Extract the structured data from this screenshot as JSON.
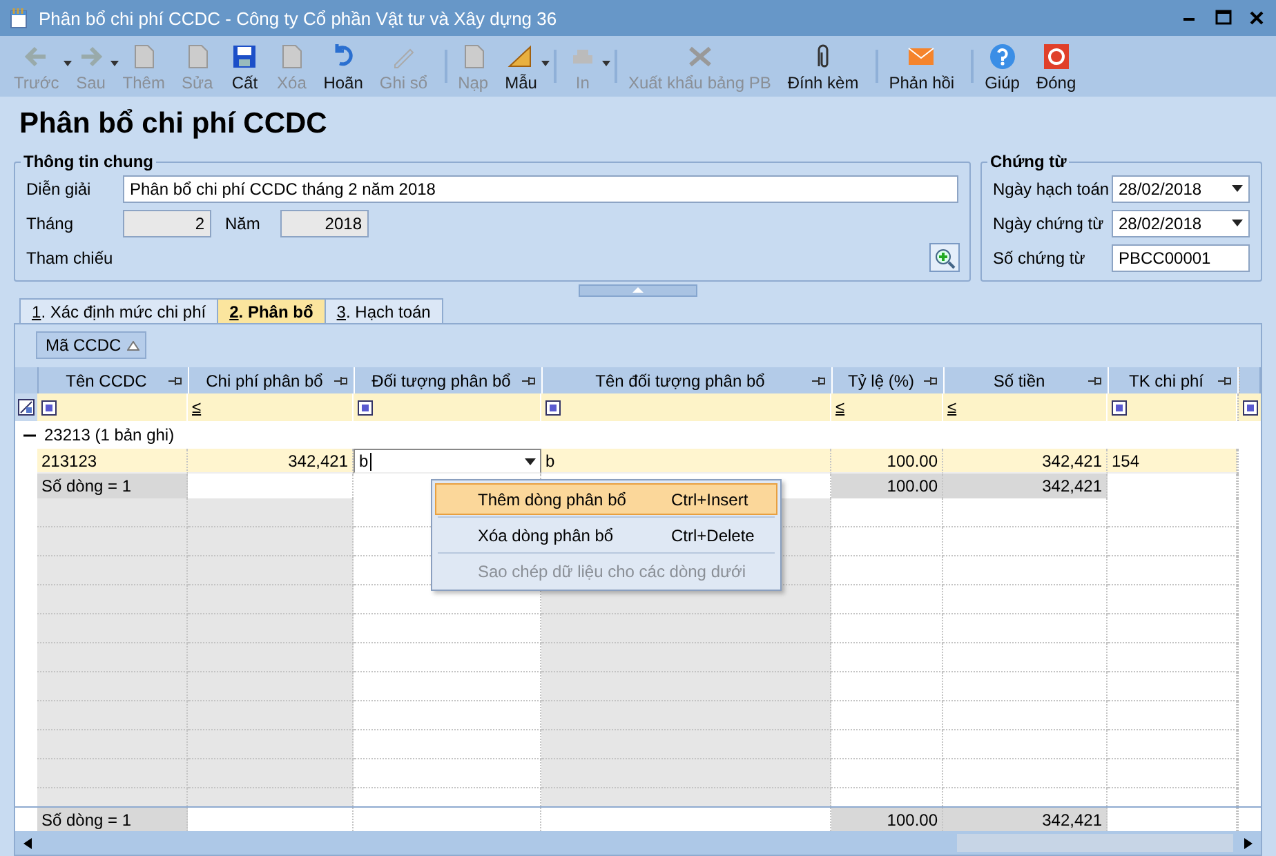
{
  "window": {
    "title": "Phân bổ chi phí CCDC - Công ty Cổ phần Vật tư và Xây dựng 36"
  },
  "toolbar": [
    {
      "label": "Trước",
      "enabled": false,
      "dropdown": true,
      "separator_after": false
    },
    {
      "label": "Sau",
      "enabled": false,
      "dropdown": true,
      "separator_after": false
    },
    {
      "label": "Thêm",
      "enabled": false,
      "dropdown": false,
      "separator_after": false
    },
    {
      "label": "Sửa",
      "enabled": false,
      "dropdown": false,
      "separator_after": false
    },
    {
      "label": "Cất",
      "enabled": true,
      "dropdown": false,
      "separator_after": false
    },
    {
      "label": "Xóa",
      "enabled": false,
      "dropdown": false,
      "separator_after": false
    },
    {
      "label": "Hoãn",
      "enabled": true,
      "dropdown": false,
      "separator_after": false
    },
    {
      "label": "Ghi sổ",
      "enabled": false,
      "dropdown": false,
      "separator_after": true
    },
    {
      "label": "Nạp",
      "enabled": false,
      "dropdown": false,
      "separator_after": false
    },
    {
      "label": "Mẫu",
      "enabled": true,
      "dropdown": true,
      "separator_after": true
    },
    {
      "label": "In",
      "enabled": false,
      "dropdown": true,
      "separator_after": true
    },
    {
      "label": "Xuất khẩu bảng PB",
      "enabled": false,
      "dropdown": false,
      "separator_after": false
    },
    {
      "label": "Đính kèm",
      "enabled": true,
      "dropdown": false,
      "separator_after": true
    },
    {
      "label": "Phản hồi",
      "enabled": true,
      "dropdown": false,
      "separator_after": true
    },
    {
      "label": "Giúp",
      "enabled": true,
      "dropdown": false,
      "separator_after": false
    },
    {
      "label": "Đóng",
      "enabled": true,
      "dropdown": false,
      "separator_after": false
    }
  ],
  "heading": "Phân bổ chi phí CCDC",
  "general": {
    "title": "Thông tin chung",
    "description_label": "Diễn giải",
    "description": "Phân bổ chi phí CCDC tháng 2 năm 2018",
    "month_label": "Tháng",
    "month": "2",
    "year_label": "Năm",
    "year": "2018",
    "reference_label": "Tham chiếu"
  },
  "voucher": {
    "title": "Chứng từ",
    "fields": [
      {
        "label": "Ngày hạch toán",
        "value": "28/02/2018",
        "kind": "date"
      },
      {
        "label": "Ngày chứng từ",
        "value": "28/02/2018",
        "kind": "date"
      },
      {
        "label": "Số chứng từ",
        "value": "PBCC00001",
        "kind": "text"
      }
    ]
  },
  "tabs": [
    {
      "key": "1",
      "label": ". Xác định mức chi phí",
      "selected": false
    },
    {
      "key": "2",
      "label": ". Phân bổ",
      "selected": true
    },
    {
      "key": "3",
      "label": ". Hạch toán",
      "selected": false
    }
  ],
  "group_by": {
    "label": "Mã CCDC"
  },
  "table": {
    "columns": [
      {
        "label": "Tên CCDC",
        "readonly": true
      },
      {
        "label": "Chi phí phân bổ",
        "readonly": true,
        "filter_operator": "≤"
      },
      {
        "label": "Đối tượng phân bổ",
        "readonly": false
      },
      {
        "label": "Tên đối tượng phân bổ",
        "readonly": true
      },
      {
        "label": "Tỷ lệ (%)",
        "readonly": false,
        "filter_operator": "≤"
      },
      {
        "label": "Số tiền",
        "readonly": false,
        "filter_operator": "≤"
      },
      {
        "label": "TK chi phí",
        "readonly": false
      }
    ],
    "group": {
      "label": "23213 (1 bản ghi)",
      "expanded": true
    },
    "rows": [
      {
        "cells": [
          "213123",
          "342,421",
          "b",
          "b",
          "100.00",
          "342,421",
          "154"
        ]
      }
    ],
    "group_summary": {
      "count": "Số dòng = 1",
      "ratio_total": "100.00",
      "amount_total": "342,421"
    },
    "footer": {
      "count": "Số dòng = 1",
      "ratio_total": "100.00",
      "amount_total": "342,421"
    }
  },
  "context_menu": [
    {
      "label": "Thêm dòng phân bổ",
      "shortcut": "Ctrl+Insert",
      "selected": true,
      "disabled": false
    },
    {
      "label": "Xóa dòng phân bổ",
      "shortcut": "Ctrl+Delete",
      "selected": false,
      "disabled": false
    },
    {
      "label": "Sao chép dữ liệu cho các dòng dưới",
      "selected": false,
      "disabled": true
    }
  ]
}
